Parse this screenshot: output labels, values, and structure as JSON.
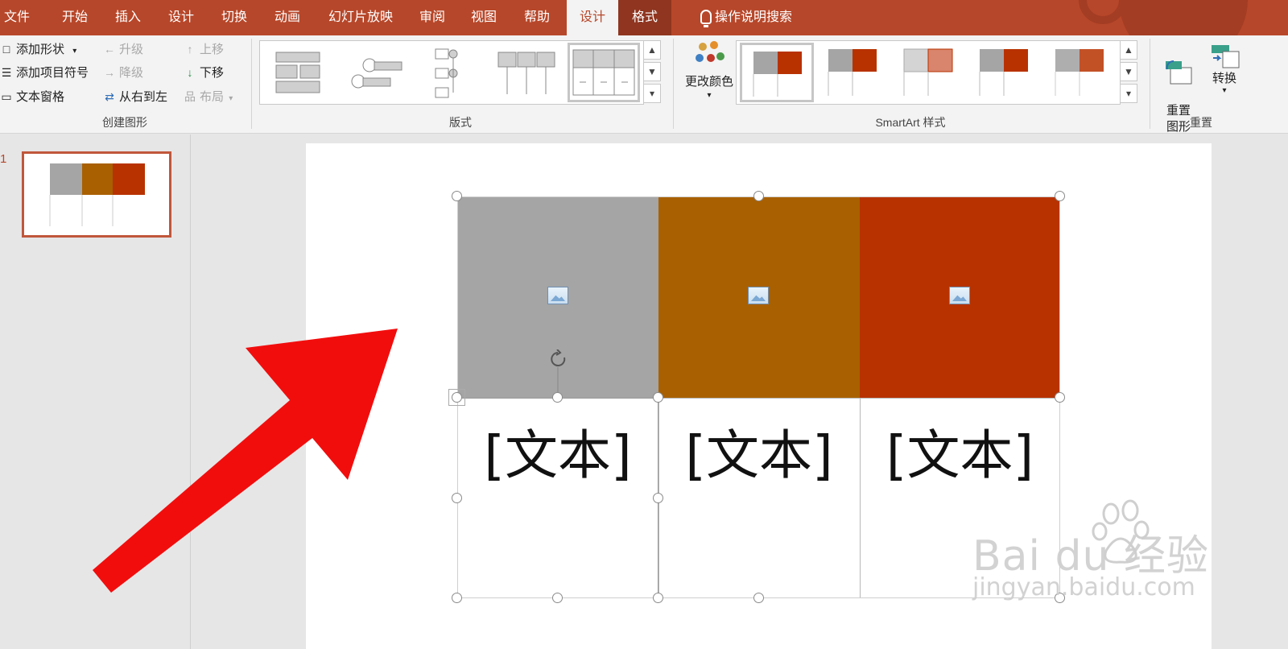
{
  "tabs": [
    "文件",
    "开始",
    "插入",
    "设计",
    "切换",
    "动画",
    "幻灯片放映",
    "审阅",
    "视图",
    "帮助",
    "设计",
    "格式"
  ],
  "active_tab": "设计",
  "search": {
    "label": "操作说明搜索",
    "icon": "lightbulb-icon"
  },
  "ribbon": {
    "create_graphic": {
      "add_shape": "添加形状",
      "add_bullet": "添加项目符号",
      "text_pane": "文本窗格",
      "promote": "升级",
      "demote": "降级",
      "right_to_left": "从右到左",
      "move_up": "上移",
      "move_down": "下移",
      "layout": "布局",
      "group_label": "创建图形"
    },
    "layouts": {
      "group_label": "版式"
    },
    "styles": {
      "change_colors": "更改颜色",
      "group_label": "SmartArt 样式"
    },
    "reset": {
      "reset_graphic": "重置\n图形",
      "convert": "转换",
      "group_label": "重置"
    }
  },
  "slides": [
    {
      "number": "1"
    }
  ],
  "smartart": {
    "colors": {
      "gray": "#a5a5a5",
      "orange": "#a96000",
      "red": "#b83200",
      "tab_bar": "#b7472a"
    },
    "texts": [
      "[文本]",
      "[文本]",
      "[文本]"
    ]
  },
  "watermark": {
    "brand": "Bai du 经验",
    "url": "jingyan.baidu.com"
  }
}
